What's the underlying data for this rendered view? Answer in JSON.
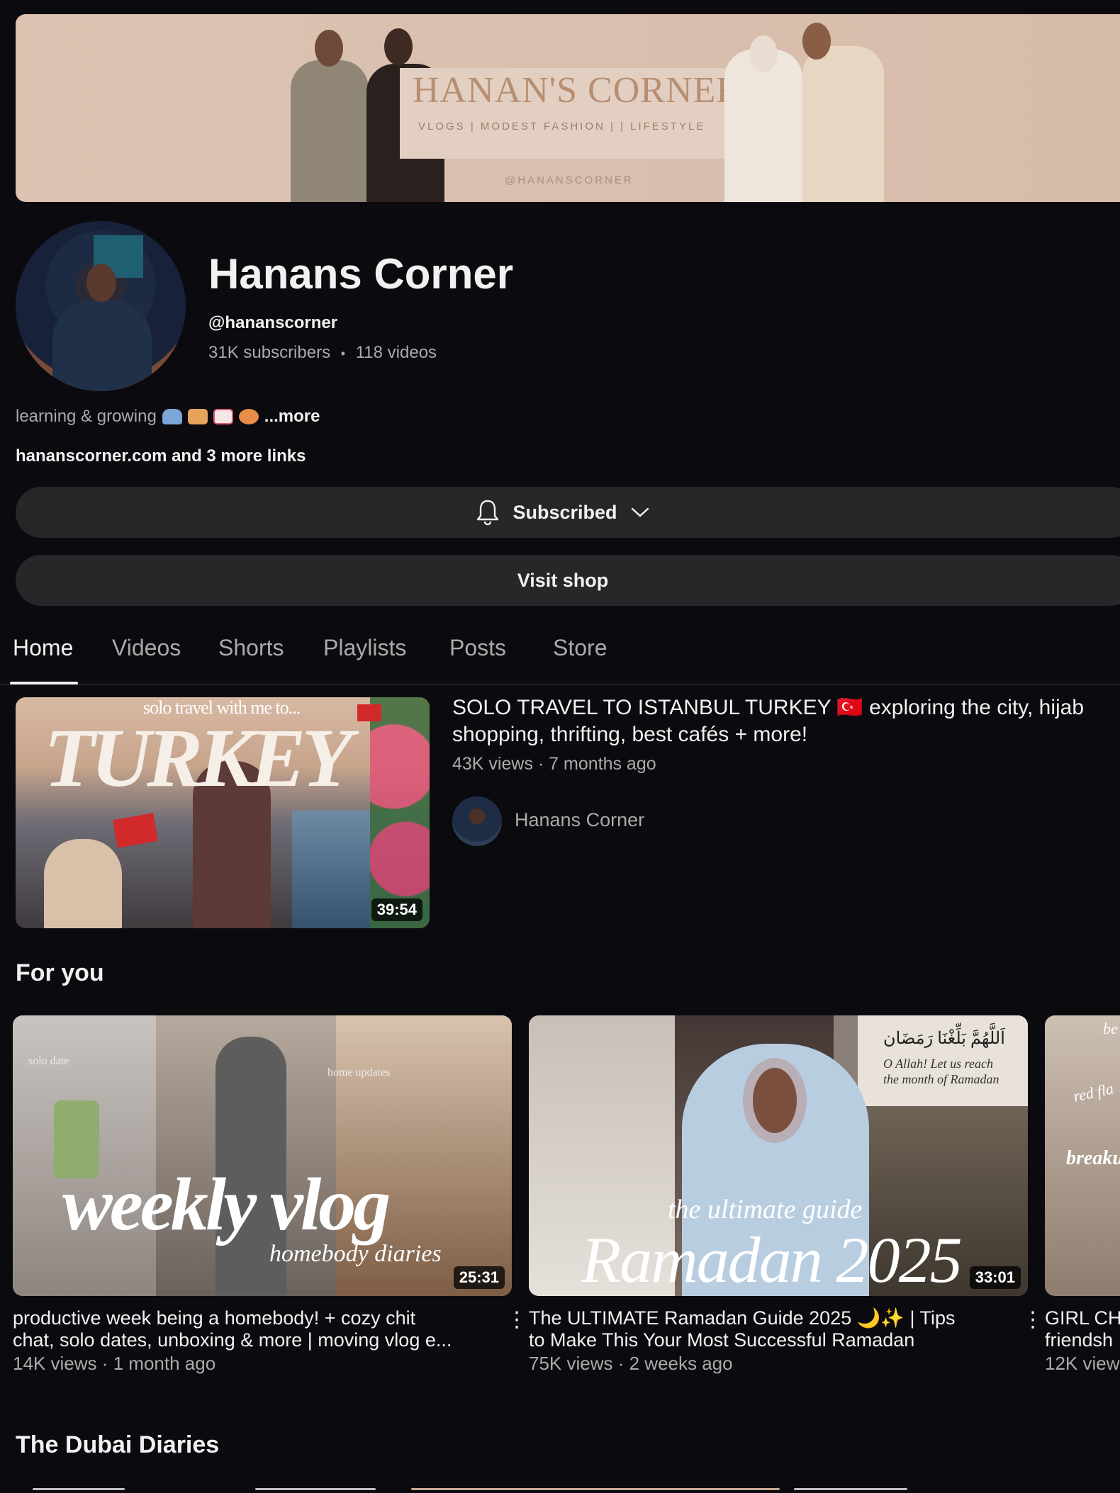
{
  "banner": {
    "title": "HANAN'S CORNER",
    "subtitle": "VLOGS | MODEST FASHION |  | LIFESTYLE",
    "handle": "@HANANSCORNER"
  },
  "channel": {
    "name": "Hanans Corner",
    "handle": "@hananscorner",
    "subscribers": "31K subscribers",
    "separator": "•",
    "videos": "118 videos",
    "description": "learning & growing",
    "more_label": "...more",
    "links": "hananscorner.com and 3 more links"
  },
  "buttons": {
    "subscribed_label": "Subscribed",
    "shop_label": "Visit shop"
  },
  "tabs": [
    {
      "label": "Home",
      "active": true
    },
    {
      "label": "Videos"
    },
    {
      "label": "Shorts"
    },
    {
      "label": "Playlists"
    },
    {
      "label": "Posts"
    },
    {
      "label": "Store"
    }
  ],
  "featured": {
    "thumb_top_text": "solo travel with me to...",
    "thumb_big_text": "TURKEY",
    "duration": "39:54",
    "title": "SOLO TRAVEL TO ISTANBUL TURKEY 🇹🇷 exploring the city, hijab shopping, thrifting, best cafés + more!",
    "title_line1": "SOLO TRAVEL TO ISTANBUL TURKEY 🇹🇷 exploring the city, hijab",
    "title_line2": "shopping, thrifting, best cafés + more!",
    "meta": "43K views · 7 months ago",
    "channel": "Hanans Corner"
  },
  "sections": {
    "for_you": "For you",
    "dubai": "The Dubai Diaries"
  },
  "for_you": [
    {
      "thumb_labels": [
        "solo date",
        "home updates"
      ],
      "thumb_big": "weekly vlog",
      "thumb_small": "homebody diaries",
      "duration": "25:31",
      "title_line1": "productive week being a homebody! + cozy chit",
      "title_line2": "chat, solo dates, unboxing & more  | moving vlog e...",
      "meta": "14K views · 1 month ago"
    },
    {
      "thumb_arabic": "اَللَّهُمَّ بَلِّغْنَا رَمَضَان",
      "thumb_quote_line1": "O Allah! Let us reach",
      "thumb_quote_line2": "the month of Ramadan",
      "thumb_small": "the ultimate guide",
      "thumb_big": "Ramadan 2025",
      "duration": "33:01",
      "title_line1": "The ULTIMATE Ramadan Guide 2025 🌙✨ |  Tips",
      "title_line2": "to Make This Your Most Successful Ramadan",
      "meta": "75K views · 2 weeks ago"
    },
    {
      "thumb_labels": [
        "be",
        "red fla",
        "breaku"
      ],
      "title_line1": "GIRL CH",
      "title_line2": "friendsh",
      "meta": "12K view"
    }
  ],
  "icons": {
    "bell": "bell-icon",
    "chevron": "chevron-down-icon",
    "kebab": "more-vert-icon"
  },
  "colors": {
    "background": "#0b0a0e",
    "button": "#272629",
    "secondary_text": "#aaaaaa",
    "banner": "#dcc3b1"
  }
}
